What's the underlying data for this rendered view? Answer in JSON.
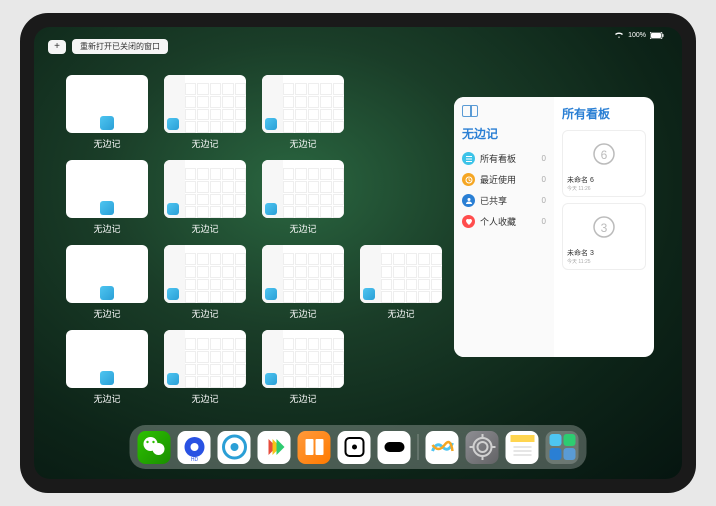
{
  "statusbar": {
    "wifi": "wifi",
    "battery": "100%"
  },
  "topleft": {
    "add": "+",
    "reopen": "重新打开已关闭的窗口"
  },
  "windows": [
    {
      "type": "blank",
      "label": "无边记"
    },
    {
      "type": "cal",
      "label": "无边记"
    },
    {
      "type": "cal",
      "label": "无边记"
    },
    {
      "type": "blank",
      "label": "无边记"
    },
    {
      "type": "cal",
      "label": "无边记"
    },
    {
      "type": "cal",
      "label": "无边记"
    },
    {
      "type": "blank",
      "label": "无边记"
    },
    {
      "type": "cal",
      "label": "无边记"
    },
    {
      "type": "cal",
      "label": "无边记"
    },
    {
      "type": "cal",
      "label": "无边记"
    },
    {
      "type": "blank",
      "label": "无边记"
    },
    {
      "type": "cal",
      "label": "无边记"
    },
    {
      "type": "cal",
      "label": "无边记"
    }
  ],
  "panel": {
    "title": "无边记",
    "rows": [
      {
        "icon": "list",
        "color": "#3cc3e8",
        "label": "所有看板",
        "count": "0"
      },
      {
        "icon": "clock",
        "color": "#f5a623",
        "label": "最近使用",
        "count": "0"
      },
      {
        "icon": "person",
        "color": "#2a7fd4",
        "label": "已共享",
        "count": "0"
      },
      {
        "icon": "heart",
        "color": "#ff4d4d",
        "label": "个人收藏",
        "count": "0"
      }
    ],
    "rightTitle": "所有看板",
    "cards": [
      {
        "sketch": "6",
        "label": "未命名 6",
        "sub": "今天 11:26"
      },
      {
        "sketch": "3",
        "label": "未命名 3",
        "sub": "今天 11:25"
      }
    ]
  },
  "dock": {
    "icons": [
      "wechat",
      "quark",
      "browser",
      "play",
      "books",
      "dice",
      "camera",
      "freeform",
      "settings",
      "notes",
      "folder"
    ]
  }
}
